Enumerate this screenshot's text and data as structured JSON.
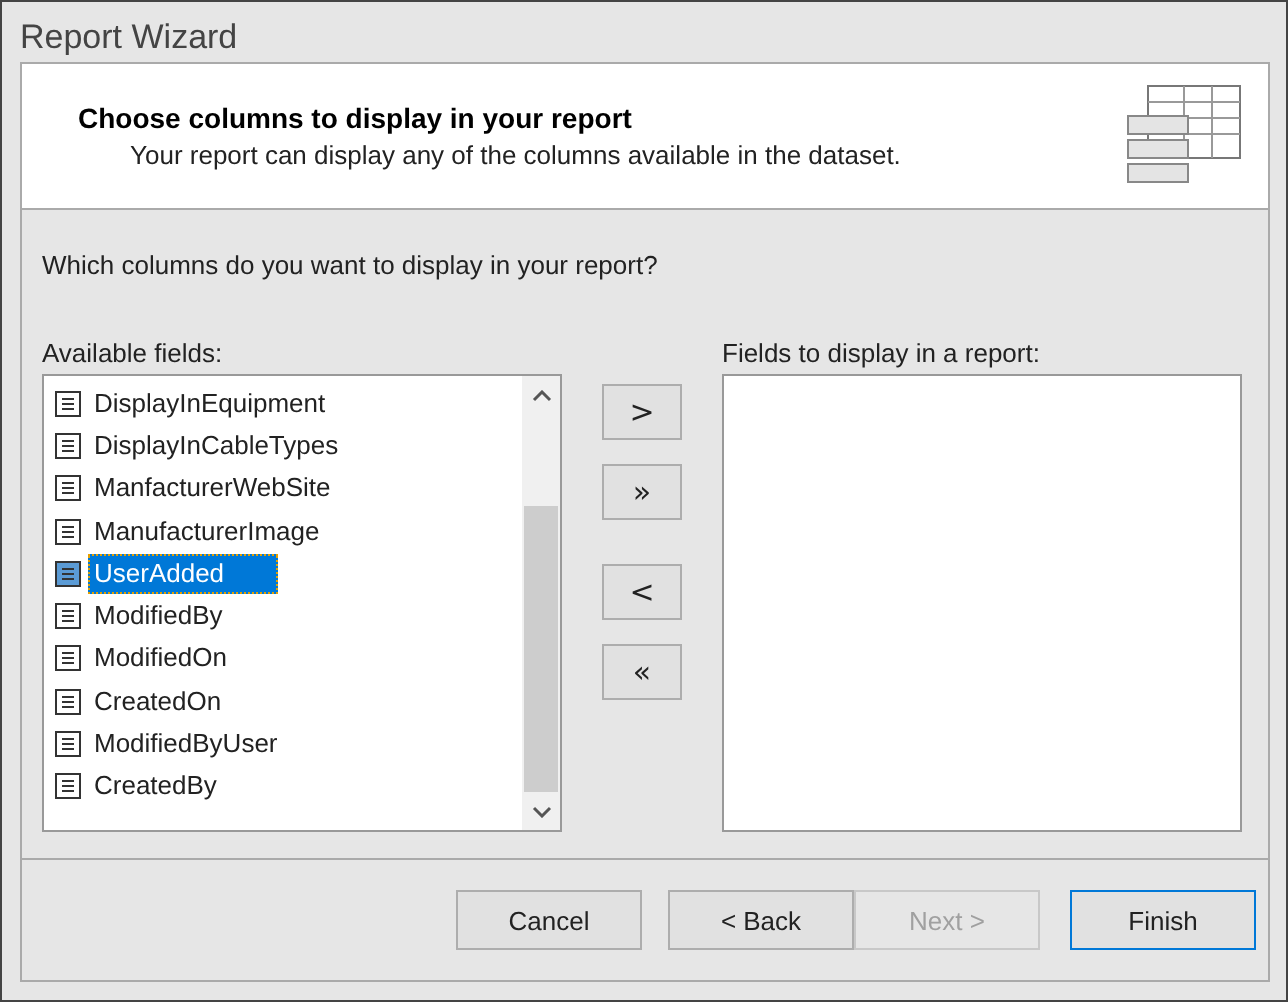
{
  "window": {
    "title": "Report Wizard"
  },
  "header": {
    "title": "Choose columns to display in your report",
    "subtitle": "Your report can display any of the columns available in the dataset."
  },
  "question": "Which columns do you want to display in your report?",
  "available": {
    "label": "Available fields:",
    "items": [
      {
        "name": "DisplayInEquipment",
        "selected": false
      },
      {
        "name": "DisplayInCableTypes",
        "selected": false
      },
      {
        "name": "ManfacturerWebSite",
        "selected": false
      },
      {
        "name": "ManufacturerImage",
        "selected": false
      },
      {
        "name": "UserAdded",
        "selected": true
      },
      {
        "name": "ModifiedBy",
        "selected": false
      },
      {
        "name": "ModifiedOn",
        "selected": false
      },
      {
        "name": "CreatedOn",
        "selected": false
      },
      {
        "name": "ModifiedByUser",
        "selected": false
      },
      {
        "name": "CreatedBy",
        "selected": false
      }
    ]
  },
  "move_buttons": [
    ">",
    "»",
    "<",
    "«"
  ],
  "selected_fields": {
    "label": "Fields to display in a report:"
  },
  "buttons": [
    {
      "label": "Cancel",
      "disabled": false,
      "default": false
    },
    {
      "label": "< Back",
      "disabled": false,
      "default": false
    },
    {
      "label": "Next >",
      "disabled": true,
      "default": false
    },
    {
      "label": "Finish",
      "disabled": false,
      "default": true
    }
  ]
}
